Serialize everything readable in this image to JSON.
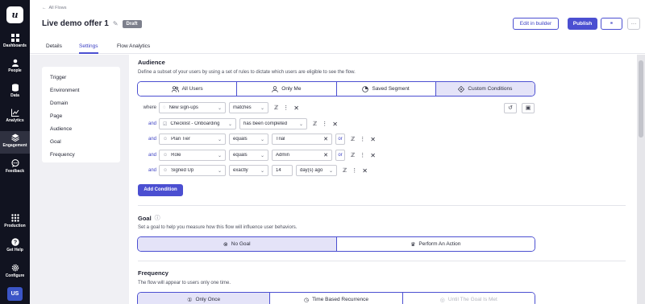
{
  "nav": {
    "logo": "u",
    "items": [
      {
        "label": "Dashboards",
        "icon": "grid-icon"
      },
      {
        "label": "People",
        "icon": "person-icon"
      },
      {
        "label": "Data",
        "icon": "database-icon"
      },
      {
        "label": "Analytics",
        "icon": "chart-icon"
      },
      {
        "label": "Engagement",
        "icon": "layers-icon"
      },
      {
        "label": "Feedback",
        "icon": "chat-icon"
      },
      {
        "label": "Production",
        "icon": "apps-icon"
      },
      {
        "label": "Get Help",
        "icon": "help-icon"
      },
      {
        "label": "Configure",
        "icon": "gear-icon"
      }
    ],
    "avatar": "US"
  },
  "header": {
    "back_label": "All Flows",
    "title": "Live demo offer 1",
    "status": "Draft",
    "edit_button": "Edit in builder",
    "publish_button": "Publish",
    "link_icon": "⚭",
    "more_icon": "···"
  },
  "tabs": [
    "Details",
    "Settings",
    "Flow Analytics"
  ],
  "side_menu": [
    "Trigger",
    "Environment",
    "Domain",
    "Page",
    "Audience",
    "Goal",
    "Frequency"
  ],
  "audience": {
    "title": "Audience",
    "description": "Define a subset of your users by using a set of rules to dictate which users are eligible to see the flow.",
    "options": [
      "All Users",
      "Only Me",
      "Saved Segment",
      "Custom Conditions"
    ],
    "conditions": [
      {
        "connector": "where",
        "property": "New sign-ups",
        "operator": "matches"
      },
      {
        "connector": "and",
        "property": "Checklist - Onboarding",
        "operator": "has been completed"
      },
      {
        "connector": "and",
        "property": "Plan Tier",
        "operator": "equals",
        "value": "Trial",
        "or": "or"
      },
      {
        "connector": "and",
        "property": "Role",
        "operator": "equals",
        "value": "Admin",
        "or": "or"
      },
      {
        "connector": "and",
        "property": "Signed Up",
        "operator": "exactly",
        "value": "14",
        "unit": "day(s) ago"
      }
    ],
    "add_condition": "Add Condition"
  },
  "goal": {
    "title": "Goal",
    "description": "Set a goal to help you measure how this flow will influence user behaviors.",
    "options": [
      "No Goal",
      "Perform An Action"
    ]
  },
  "frequency": {
    "title": "Frequency",
    "description": "The flow will appear to users only one time.",
    "options": [
      "Only Once",
      "Time Based Recurrence",
      "Until The Goal Is Met"
    ]
  },
  "colors": {
    "accent": "#4b4fd1",
    "nav_bg": "#111320",
    "selected_bg": "#e4e3f8"
  }
}
